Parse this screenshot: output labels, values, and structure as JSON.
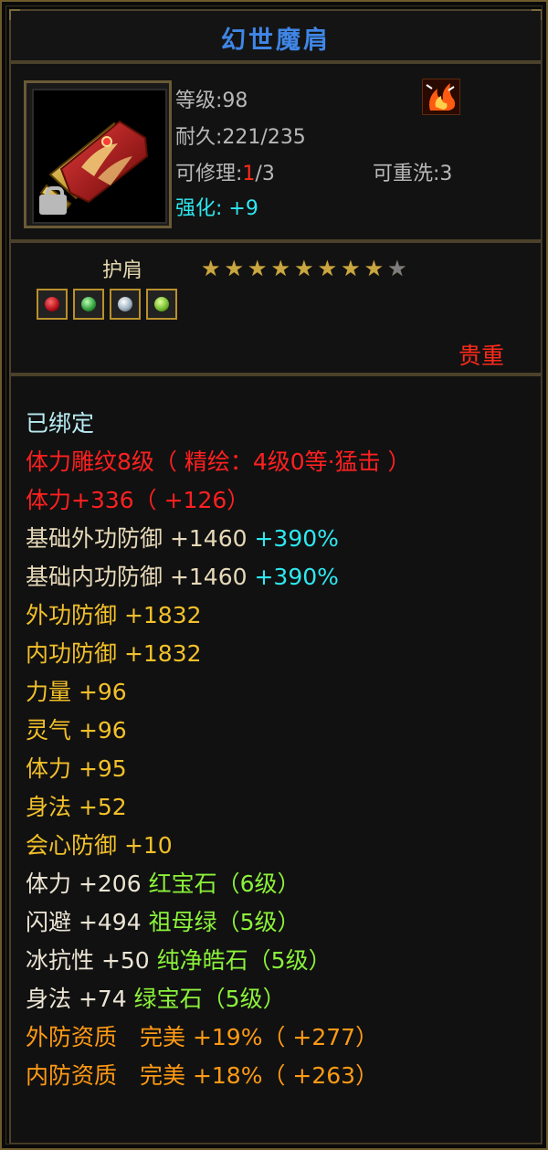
{
  "title": "幻世魔肩",
  "header": {
    "level": "等级:98",
    "durability": "耐久:221/235",
    "repair_prefix": "可修理:",
    "repair_used": "1",
    "repair_total": "/3",
    "rewash": "可重洗:3",
    "enhance_label": "强化:",
    "enhance_value": "+9"
  },
  "type_label": "护肩",
  "stars": {
    "filled": 8,
    "total": 9
  },
  "gems": [
    "red-gem-icon",
    "green-gem-icon",
    "white-gem-icon",
    "green-yellow-gem-icon"
  ],
  "rarity": "贵重",
  "attributes": {
    "bound": "已绑定",
    "engrave": "体力雕纹8级（ 精绘：4级0等·猛击 ）",
    "vit_bonus": "体力+336（ +126）",
    "base_outer_def": "基础外功防御 +1460",
    "base_outer_def_pct": "+390%",
    "base_inner_def": "基础内功防御 +1460",
    "base_inner_def_pct": "+390%",
    "outer_def": "外功防御 +1832",
    "inner_def": "内功防御 +1832",
    "strength": "力量 +96",
    "spirit": "灵气 +96",
    "vitality": "体力 +95",
    "agility": "身法 +52",
    "crit_def": "会心防御 +10",
    "gem1_stat": "体力 +206",
    "gem1_name": "红宝石（6级）",
    "gem2_stat": "闪避 +494",
    "gem2_name": "祖母绿（5级）",
    "gem3_stat": "冰抗性 +50",
    "gem3_name": "纯净皓石（5级）",
    "gem4_stat": "身法 +74",
    "gem4_name": "绿宝石（5级）",
    "outer_quality": "外防资质　完美 +19%（ +277）",
    "inner_quality": "内防资质　完美 +18%（ +263）"
  }
}
